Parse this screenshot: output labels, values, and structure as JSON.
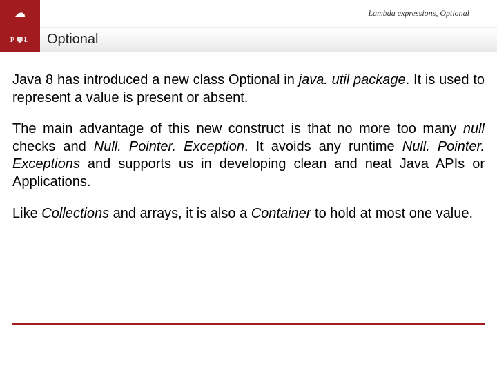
{
  "header": {
    "breadcrumb": "Lambda expressions, Optional",
    "logo_top_glyph": "☁",
    "logo_bottom_left": "P",
    "logo_bottom_right": "Ł"
  },
  "section": {
    "title": "Optional"
  },
  "body": {
    "p1_a": "Java 8 has introduced a new class Optional in ",
    "p1_i1": "java. util package",
    "p1_b": ". It is used to represent a value is present or absent.",
    "p2_a": "The main advantage of this new construct is that no more too many ",
    "p2_i1": "null",
    "p2_b": " checks and ",
    "p2_i2": "Null. Pointer. Exception",
    "p2_c": ". It avoids any runtime ",
    "p2_i3": "Null. Pointer. Exceptions",
    "p2_d": " and supports us in developing clean and neat Java APIs or Applications.",
    "p3_a": "Like ",
    "p3_i1": "Collections",
    "p3_b": " and arrays, it is also a ",
    "p3_i2": "Container",
    "p3_c": " to hold at most one value."
  }
}
